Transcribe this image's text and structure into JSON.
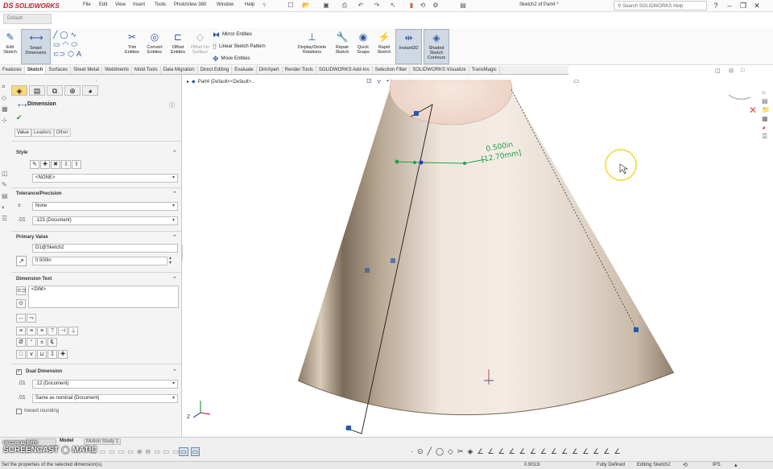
{
  "titlebar": {
    "logo_text": "SOLIDWORKS",
    "logo_prefix": "DS",
    "menus": [
      "File",
      "Edit",
      "View",
      "Insert",
      "Tools",
      "PhotoView 360",
      "Window",
      "Help"
    ],
    "document_title": "Sketch2 of Part4 *",
    "search_placeholder": "Search SOLIDWORKS Help"
  },
  "config": {
    "name": "Default"
  },
  "commands": {
    "edit_sketch": "Edit Sketch",
    "smart_dimension": "Smart Dimension",
    "trim_entities": "Trim Entities",
    "convert_entities": "Convert Entities",
    "offset_entities": "Offset Entities",
    "offset_on_surface": "Offset On Surface",
    "mirror_entities": "Mirror Entities",
    "linear_sketch_pattern": "Linear Sketch Pattern",
    "move_entities": "Move Entities",
    "display_delete_relations": "Display/Delete Relations",
    "repair_sketch": "Repair Sketch",
    "quick_snaps": "Quick Snaps",
    "rapid_sketch": "Rapid Sketch",
    "instant2d": "Instant2D",
    "shaded_sketch_contours": "Shaded Sketch Contours"
  },
  "tabs": [
    "Features",
    "Sketch",
    "Surfaces",
    "Sheet Metal",
    "Weldments",
    "Mold Tools",
    "Data Migration",
    "Direct Editing",
    "Evaluate",
    "DimXpert",
    "Render Tools",
    "SOLIDWORKS Add-Ins",
    "Selection Filter",
    "SOLIDWORKS Visualize",
    "TransMagic"
  ],
  "selected_tab": "Sketch",
  "pm": {
    "title": "Dimension",
    "subtabs": [
      "Value",
      "Leaders",
      "Other"
    ],
    "style_label": "Style",
    "style_value": "<NONE>",
    "tolerance_label": "Tolerance/Precision",
    "tolerance_type": "None",
    "precision": ".123 (Document)",
    "primary_value_label": "Primary Value",
    "primary_name": "D1@Sketch2",
    "primary_value": "0.500in",
    "dimension_text_label": "Dimension Text",
    "dimension_text": "<DIM>",
    "dual_dimension_label": "Dual Dimension",
    "dual_precision": ".12 (Document)",
    "dual_tolerance": "Same as nominal (Document)",
    "inward_rounding_label": "Inward rounding"
  },
  "viewport": {
    "tree_label": "Part4  (Default<<Default>...",
    "dim_value_in": "0.500in",
    "dim_value_mm": "[12.70mm]",
    "triad_z": "Z"
  },
  "bottom": {
    "tabs": [
      "Model",
      "Motion Study 1"
    ],
    "watermark_top": "RECORDED WITH",
    "watermark_main": "SCREENCAST",
    "watermark_tail": "MATIC"
  },
  "status": {
    "message": "Set the properties of the selected dimension(s).",
    "coordinate": "0.9013i",
    "sketch_state": "Fully Defined",
    "editing": "Editing Sketch2",
    "units": "IPS"
  },
  "colors": {
    "accent_blue": "#2b5aa8",
    "dimension_green": "#1aa34a",
    "tab_highlight": "#f9d97a"
  }
}
